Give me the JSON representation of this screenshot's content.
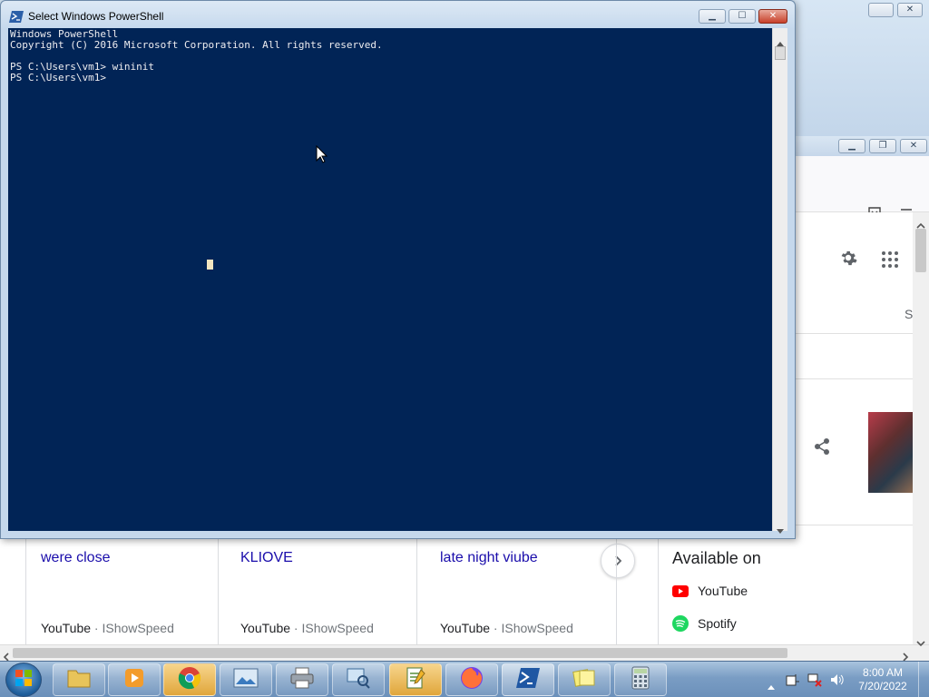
{
  "powershell": {
    "title": "Select Windows PowerShell",
    "console_lines": [
      "Windows PowerShell",
      "Copyright (C) 2016 Microsoft Corporation. All rights reserved.",
      "",
      "PS C:\\Users\\vm1> wininit",
      "PS C:\\Users\\vm1>"
    ],
    "background_color": "#012456",
    "text_color": "#eeedf0"
  },
  "browser": {
    "partial_label": "S",
    "cards": [
      {
        "title": "were close",
        "source": "YouTube",
        "channel": "IShowSpeed"
      },
      {
        "title": "KLIOVE",
        "source": "YouTube",
        "channel": "IShowSpeed"
      },
      {
        "title": "late night viube",
        "source": "YouTube",
        "channel": "IShowSpeed"
      }
    ],
    "available_on": {
      "heading": "Available on",
      "items": [
        {
          "label": "YouTube",
          "icon": "youtube-icon",
          "color": "#ff0000"
        },
        {
          "label": "Spotify",
          "icon": "spotify-icon",
          "color": "#1ed760"
        }
      ]
    },
    "link_color": "#1a0dab"
  },
  "taskbar": {
    "apps": [
      "windows-explorer",
      "media-player",
      "chrome",
      "photo-viewer",
      "printer",
      "network-search",
      "notepad-plus",
      "firefox",
      "powershell",
      "sticky-notes",
      "calculator"
    ],
    "clock_time": "8:00 AM",
    "clock_date": "7/20/2022"
  }
}
